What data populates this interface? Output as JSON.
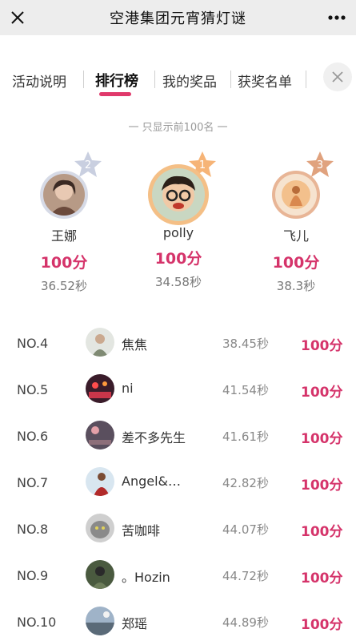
{
  "nav": {
    "title": "空港集团元宵猜灯谜",
    "close_icon": "close-icon",
    "more_icon": "more-icon"
  },
  "tabs": [
    {
      "label": "活动说明",
      "active": false
    },
    {
      "label": "排行榜",
      "active": true
    },
    {
      "label": "我的奖品",
      "active": false
    },
    {
      "label": "获奖名单",
      "active": false
    }
  ],
  "subtitle": "一 只显示前100名 一",
  "accent_color": "#d5336a",
  "podium": [
    {
      "rank_badge": "2",
      "name": "王娜",
      "score": "100分",
      "time": "36.52秒"
    },
    {
      "rank_badge": "1",
      "name": "polly",
      "score": "100分",
      "time": "34.58秒"
    },
    {
      "rank_badge": "3",
      "name": "飞儿",
      "score": "100分",
      "time": "38.3秒"
    }
  ],
  "ranking": [
    {
      "rank": "NO.4",
      "name": "焦焦",
      "time": "38.45秒",
      "score": "100分"
    },
    {
      "rank": "NO.5",
      "name": "ni",
      "time": "41.54秒",
      "score": "100分"
    },
    {
      "rank": "NO.6",
      "name": "差不多先生",
      "time": "41.61秒",
      "score": "100分"
    },
    {
      "rank": "NO.7",
      "name": "Angel&…",
      "time": "42.82秒",
      "score": "100分"
    },
    {
      "rank": "NO.8",
      "name": "苦咖啡",
      "time": "44.07秒",
      "score": "100分"
    },
    {
      "rank": "NO.9",
      "name": "。Hozin",
      "time": "44.72秒",
      "score": "100分"
    },
    {
      "rank": "NO.10",
      "name": "郑瑶",
      "time": "44.89秒",
      "score": "100分"
    }
  ]
}
